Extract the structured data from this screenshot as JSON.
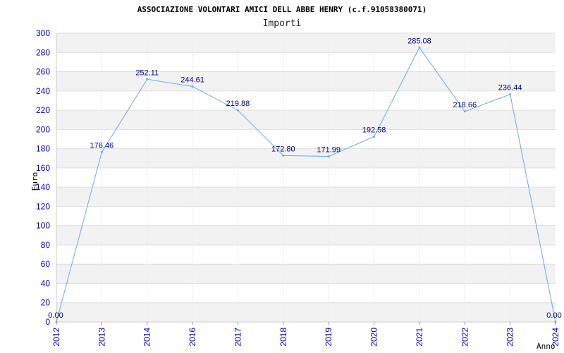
{
  "chart": {
    "title": "ASSOCIAZIONE VOLONTARI AMICI DELL ABBE HENRY (c.f.91058380071)",
    "subtitle": "Importi",
    "ylabel": "Euro",
    "xlabel": "Anno"
  },
  "colors": {
    "line": "#66aaee",
    "band": "#f2f2f2",
    "grid": "#dddddd",
    "tick_text": "#0000cc",
    "data_label": "#000080"
  },
  "chart_data": {
    "type": "line",
    "title": "ASSOCIAZIONE VOLONTARI AMICI DELL ABBE HENRY (c.f.91058380071)",
    "subtitle": "Importi",
    "xlabel": "Anno",
    "ylabel": "Euro",
    "categories": [
      "2012",
      "2013",
      "2014",
      "2016",
      "2017",
      "2018",
      "2019",
      "2020",
      "2021",
      "2022",
      "2023",
      "2024"
    ],
    "values": [
      0.0,
      176.46,
      252.11,
      244.61,
      219.88,
      172.8,
      171.99,
      192.58,
      285.08,
      218.66,
      236.44,
      0.0
    ],
    "value_labels": [
      "0.00",
      "176.46",
      "252.11",
      "244.61",
      "219.88",
      "172.80",
      "171.99",
      "192.58",
      "285.08",
      "218.66",
      "236.44",
      "0.00"
    ],
    "yticks": [
      "0",
      "20",
      "40",
      "60",
      "80",
      "100",
      "120",
      "140",
      "160",
      "180",
      "200",
      "220",
      "240",
      "260",
      "280",
      "300"
    ],
    "ylim": [
      0,
      300
    ],
    "grid": true,
    "alternating_bands": true,
    "legend": "none"
  }
}
